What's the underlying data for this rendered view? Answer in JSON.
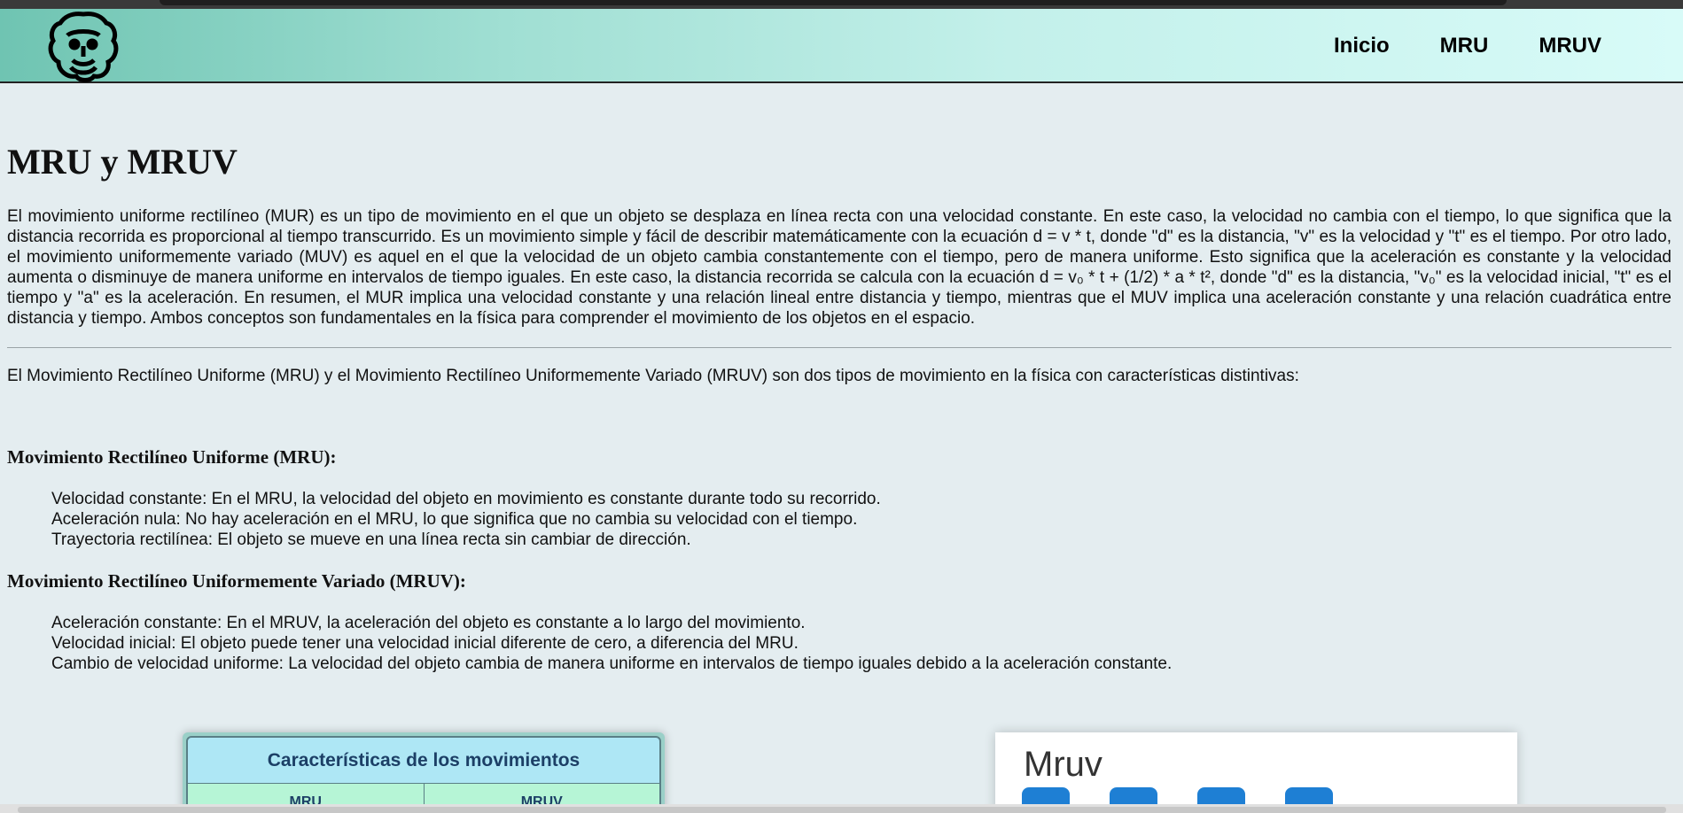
{
  "navbar": {
    "logo_icon": "philosopher-head-icon",
    "links": [
      "Inicio",
      "MRU",
      "MRUV"
    ],
    "gradient_colors": [
      "#6fc4b2",
      "#d8fbf8"
    ]
  },
  "main": {
    "title": "MRU y MRUV",
    "intro": "El movimiento uniforme rectilíneo (MUR) es un tipo de movimiento en el que un objeto se desplaza en línea recta con una velocidad constante. En este caso, la velocidad no cambia con el tiempo, lo que significa que la distancia recorrida es proporcional al tiempo transcurrido. Es un movimiento simple y fácil de describir matemáticamente con la ecuación d = v * t, donde \"d\" es la distancia, \"v\" es la velocidad y \"t\" es el tiempo. Por otro lado, el movimiento uniformemente variado (MUV) es aquel en el que la velocidad de un objeto cambia constantemente con el tiempo, pero de manera uniforme. Esto significa que la aceleración es constante y la velocidad aumenta o disminuye de manera uniforme en intervalos de tiempo iguales. En este caso, la distancia recorrida se calcula con la ecuación d = v₀ * t + (1/2) * a * t², donde \"d\" es la distancia, \"v₀\" es la velocidad inicial, \"t\" es el tiempo y \"a\" es la aceleración. En resumen, el MUR implica una velocidad constante y una relación lineal entre distancia y tiempo, mientras que el MUV implica una aceleración constante y una relación cuadrática entre distancia y tiempo. Ambos conceptos son fundamentales en la física para comprender el movimiento de los objetos en el espacio.",
    "comparison": "El Movimiento Rectilíneo Uniforme (MRU) y el Movimiento Rectilíneo Uniformemente Variado (MRUV) son dos tipos de movimiento en la física con características distintivas:",
    "mru_heading": "Movimiento Rectilíneo Uniforme (MRU):",
    "mru_items": [
      "Velocidad constante: En el MRU, la velocidad del objeto en movimiento es constante durante todo su recorrido.",
      "Aceleración nula: No hay aceleración en el MRU, lo que significa que no cambia su velocidad con el tiempo.",
      "Trayectoria rectilínea: El objeto se mueve en una línea recta sin cambiar de dirección."
    ],
    "mruv_heading": "Movimiento Rectilíneo Uniformemente Variado (MRUV):",
    "mruv_items": [
      "Aceleración constante: En el MRUV, la aceleración del objeto es constante a lo largo del movimiento.",
      "Velocidad inicial: El objeto puede tener una velocidad inicial diferente de cero, a diferencia del MRU.",
      "Cambio de velocidad uniforme: La velocidad del objeto cambia de manera uniforme en intervalos de tiempo iguales debido a la aceleración constante."
    ]
  },
  "images": {
    "table_image": {
      "header": "Características de los movimientos",
      "columns": [
        "MRU",
        "MRUV"
      ]
    },
    "mruv_image": {
      "title": "Mruv"
    }
  }
}
